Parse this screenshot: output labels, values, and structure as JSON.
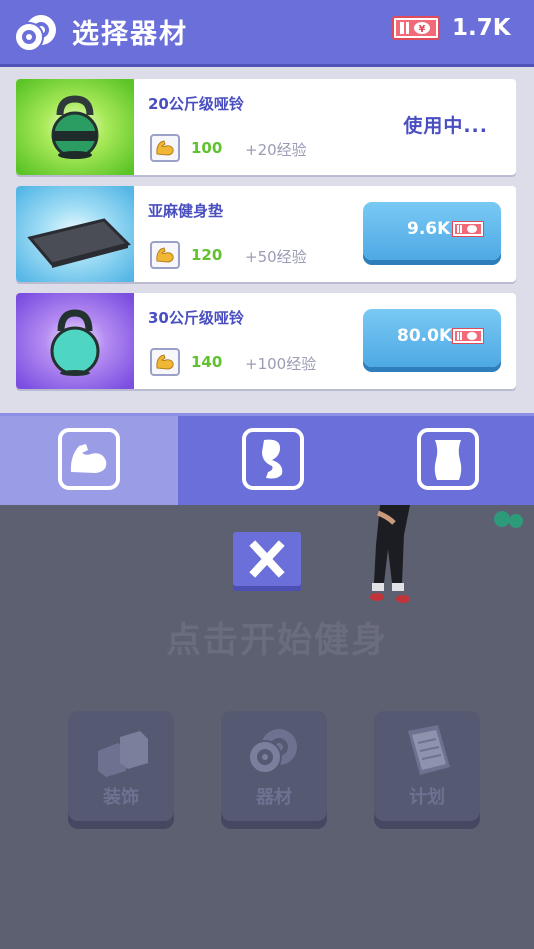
{
  "header": {
    "title": "选择器材",
    "money": "1.7K"
  },
  "items": [
    {
      "name": "20公斤级哑铃",
      "strength": "100",
      "exp": "+20经验",
      "status": "使用中...",
      "thumb": "kettlebell-icon"
    },
    {
      "name": "亚麻健身垫",
      "strength": "120",
      "exp": "+50经验",
      "price": "9.6K",
      "thumb": "yoga-mat-icon"
    },
    {
      "name": "30公斤级哑铃",
      "strength": "140",
      "exp": "+100经验",
      "price": "80.0K",
      "thumb": "kettlebell-icon"
    }
  ],
  "tabs": [
    {
      "icon": "bicep-icon",
      "selected": true
    },
    {
      "icon": "leg-icon",
      "selected": false
    },
    {
      "icon": "torso-icon",
      "selected": false
    }
  ],
  "game": {
    "start_text": "点击开始健身",
    "dock": [
      {
        "label": "装饰",
        "icon": "furniture-icon"
      },
      {
        "label": "器材",
        "icon": "dumbbell-icon"
      },
      {
        "label": "计划",
        "icon": "clipboard-icon"
      }
    ]
  },
  "colors": {
    "header": "#6b6fd9",
    "accent_text": "#4a4fc0",
    "strength_green": "#5fc22e",
    "buy_button": "#4ea9e4"
  }
}
